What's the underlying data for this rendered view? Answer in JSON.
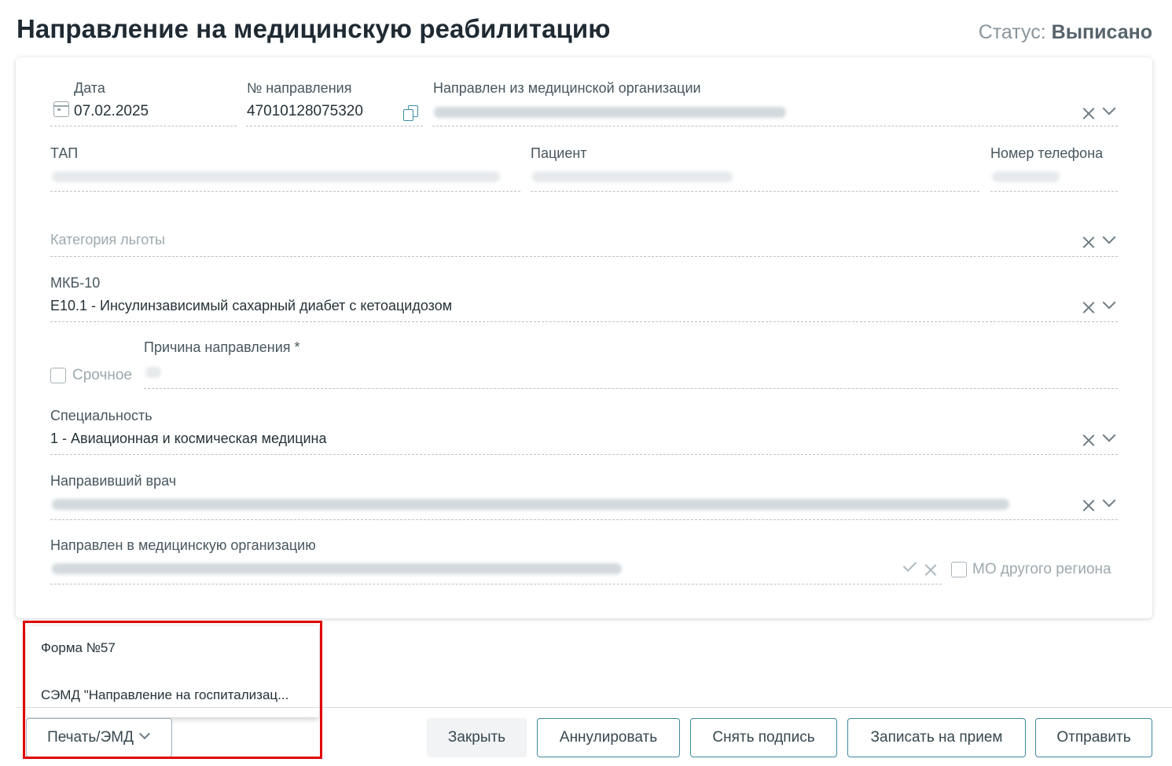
{
  "header": {
    "title": "Направление на медицинскую реабилитацию",
    "status_label": "Статус:",
    "status_value": "Выписано"
  },
  "form": {
    "date": {
      "label": "Дата",
      "value": "07.02.2025"
    },
    "referral_number": {
      "label": "№ направления",
      "value": "47010128075320"
    },
    "from_org": {
      "label": "Направлен из медицинской организации"
    },
    "tap": {
      "label": "ТАП"
    },
    "patient": {
      "label": "Пациент"
    },
    "phone": {
      "label": "Номер телефона"
    },
    "benefit_category": {
      "placeholder": "Категория льготы"
    },
    "icd10": {
      "label": "МКБ-10",
      "value": "E10.1 - Инсулинзависимый сахарный диабет с кетоацидозом"
    },
    "urgent": {
      "label": "Срочное",
      "checked": false
    },
    "reason": {
      "label": "Причина направления *"
    },
    "specialty": {
      "label": "Специальность",
      "value": "1 - Авиационная и космическая медицина"
    },
    "referring_doctor": {
      "label": "Направивший врач"
    },
    "to_org": {
      "label": "Направлен в медицинскую организацию"
    },
    "other_region": {
      "label": "МО другого региона",
      "checked": false
    }
  },
  "print_menu": {
    "items": [
      "Форма №57",
      "СЭМД \"Направление на госпитализац..."
    ]
  },
  "footer": {
    "print_label": "Печать/ЭМД",
    "close_label": "Закрыть",
    "cancel_label": "Аннулировать",
    "remove_signature_label": "Снять подпись",
    "appointment_label": "Записать на прием",
    "send_label": "Отправить"
  }
}
